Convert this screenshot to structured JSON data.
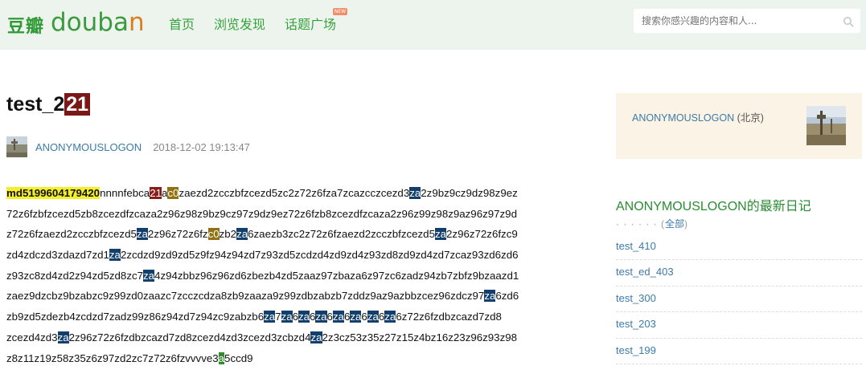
{
  "header": {
    "logo_cn": "豆瓣",
    "logo_en_1": "douba",
    "logo_en_2": "n",
    "nav": [
      "首页",
      "浏览发现",
      "话题广场"
    ],
    "new_badge": "NEW",
    "search_placeholder": "搜索你感兴趣的内容和人..."
  },
  "article": {
    "title_text": "test_2",
    "title_highlight": "21",
    "author": "ANONYMOUSLOGON",
    "date": "2018-12-02 19:13:47",
    "lines": [
      [
        [
          "md5199604179420",
          "y"
        ],
        [
          "nnnnfebca",
          ""
        ],
        [
          "21",
          "r"
        ],
        [
          "a",
          ""
        ],
        [
          "c0",
          "o"
        ],
        [
          "zaezd2zcczbfzcezd5zc2z72z6fza7zcazcczcezd3",
          ""
        ],
        [
          "za",
          "b"
        ],
        [
          "2z9bz9cz9dz98z9ez",
          ""
        ]
      ],
      [
        [
          "72z6fzbfzcezd5zb8zcezdfzcaza2z96z98z9bz9cz97z9dz9ez72z6fzb8zcezdfzcaza2z96z99z98z9az96z97z9d",
          ""
        ]
      ],
      [
        [
          "z72z6fzaezd2zcczbfzcezd5",
          ""
        ],
        [
          "za",
          "b"
        ],
        [
          "2z96z72z6fz",
          ""
        ],
        [
          "c0",
          "o"
        ],
        [
          "zb2",
          ""
        ],
        [
          "za",
          "b"
        ],
        [
          "6zaezb3zc2z72z6fzaezd2zcczbfzcezd5",
          ""
        ],
        [
          "za",
          "b"
        ],
        [
          "2z96z72z6fzc9",
          ""
        ]
      ],
      [
        [
          "zd4zdczd3zdazd7zd1",
          ""
        ],
        [
          "za",
          "b"
        ],
        [
          "2zcdzd9zd9zd5z9fz94z94zd7z93zd5zcdzd4zd9zd4z93zd8zd9zd4zd7zcaz93zd6zd6",
          ""
        ]
      ],
      [
        [
          "z93zc8zd4zd2z94zd5zd8zc7",
          ""
        ],
        [
          "za",
          "b"
        ],
        [
          "4z94zbbz96z96zd6zbezb4zd5zaaz97zbaza6z97zc6zadz94zb7zbfz9bzaazd1",
          ""
        ]
      ],
      [
        [
          "zaez9dzcbz9bzabzc9z99zd0zaazc7zcczcdza8zb9zaaza9z99zdbzabzb7zddz9az9azbbzcez96zdcz97",
          ""
        ],
        [
          "za",
          "b"
        ],
        [
          "6zd6",
          ""
        ]
      ],
      [
        [
          "zb9zd5zdezb4zcdzd7zadz99z86z94zd7z94zc9zabzb6",
          ""
        ],
        [
          "za",
          "b"
        ],
        [
          "7",
          ""
        ],
        [
          "za",
          "b"
        ],
        [
          "6",
          ""
        ],
        [
          "za",
          "b"
        ],
        [
          "6",
          ""
        ],
        [
          "za",
          "b"
        ],
        [
          "6",
          ""
        ],
        [
          "za",
          "b"
        ],
        [
          "6",
          ""
        ],
        [
          "za",
          "b"
        ],
        [
          "6",
          ""
        ],
        [
          "za",
          "b"
        ],
        [
          "6",
          ""
        ],
        [
          "za",
          "b"
        ],
        [
          "6z72z6fzdbzcazd7zd8",
          ""
        ]
      ],
      [
        [
          "zcezd4zd3",
          ""
        ],
        [
          "za",
          "b"
        ],
        [
          "2z96z72z6fzdbzcazd7zd8zcezd4zd3zcezd3zcbzd4",
          ""
        ],
        [
          "za",
          "b"
        ],
        [
          "2z3cz53z35z27z15z4bz16z23z96z93z98",
          ""
        ]
      ],
      [
        [
          "z8z11z19z58z35z6z97zd2zc7z72z6fzvvvve3",
          ""
        ],
        [
          "a",
          "g"
        ],
        [
          "5ccd9",
          ""
        ]
      ]
    ]
  },
  "sidebar": {
    "profile_name": "ANONYMOUSLOGON",
    "profile_location": " (北京)",
    "diary_title": "ANONYMOUSLOGON的最新日记",
    "all_prefix": "· · · · · · (",
    "all_link": "全部",
    "all_suffix": ")",
    "diary_list": [
      "test_410",
      "test_ed_403",
      "test_300",
      "test_203",
      "test_199"
    ]
  },
  "colors": {
    "brand_green": "#37a23d",
    "link_blue": "#3c7ba8",
    "topbar_bg": "#edf4ed",
    "profile_bg": "#fbf3e6"
  }
}
